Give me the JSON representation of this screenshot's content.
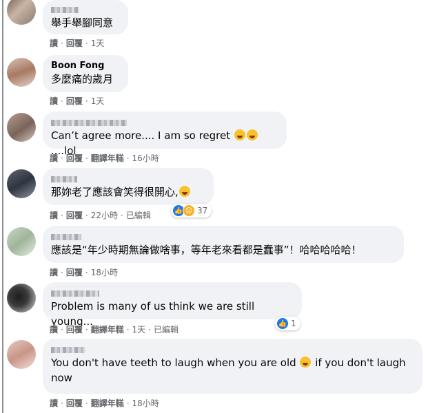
{
  "colors": {
    "bubble": "#f0f2f5",
    "meta": "#65676b",
    "like_blue": "#1877f2",
    "haha_yellow": "#f7b125"
  },
  "comments": [
    {
      "author": "",
      "text": "舉手舉腳同意",
      "actions": [
        "讀",
        "回覆"
      ],
      "time": "1天"
    },
    {
      "author": "Boon Fong",
      "text": "多麼痛的歲月",
      "actions": [
        "讀",
        "回覆"
      ],
      "time": "1天"
    },
    {
      "author": "",
      "text": "Can’t agree more.... I am so regret ",
      "text_after": "....lol",
      "actions": [
        "讀",
        "回覆",
        "翻譯年糕"
      ],
      "time": "16小時"
    },
    {
      "author": "",
      "text": "那妳老了應該會笑得很開心,",
      "actions": [
        "讀",
        "回覆"
      ],
      "time": "22小時",
      "edited": "已編輯",
      "reactions": {
        "icons": [
          "like-icon",
          "haha-icon"
        ],
        "count": "37"
      }
    },
    {
      "author": "",
      "text": "應該是“年少時期無論做啥事，等年老來看都是蠢事”！哈哈哈哈哈！",
      "actions": [
        "讀",
        "回覆"
      ],
      "time": "18小時"
    },
    {
      "author": "",
      "text": "Problem is many of us think we are still young...",
      "actions": [
        "讀",
        "回覆",
        "翻譯年糕"
      ],
      "time": "1天",
      "edited": "已編輯",
      "reactions": {
        "icons": [
          "like-icon"
        ],
        "count": "1"
      }
    },
    {
      "author": "",
      "text": "You don't have teeth to laugh when you are old ",
      "text_after": " if you don't laugh now",
      "actions": [
        "讀",
        "回覆",
        "翻譯年糕"
      ],
      "time": "18小時"
    }
  ]
}
